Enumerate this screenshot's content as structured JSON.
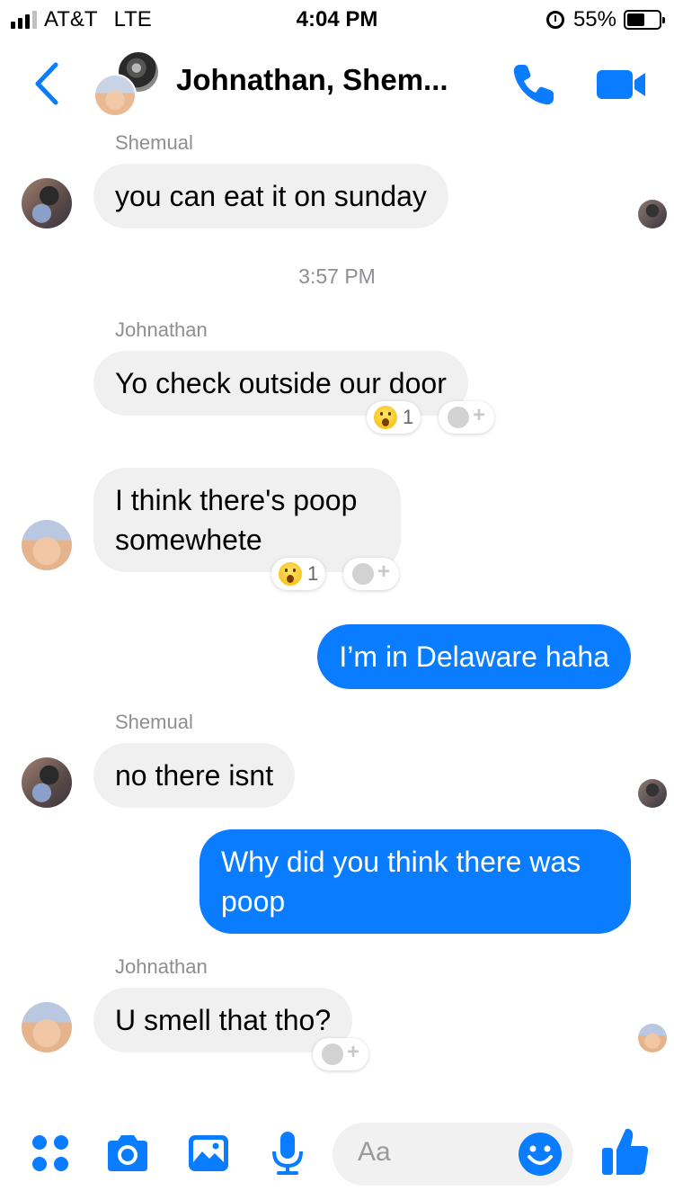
{
  "status_bar": {
    "carrier": "AT&T",
    "network": "LTE",
    "time": "4:04 PM",
    "battery": "55%",
    "battery_level": 0.55,
    "signal_bars": 3
  },
  "header": {
    "title": "Johnathan, Shem...",
    "back_icon": "chevron-left-icon",
    "call_icon": "phone-icon",
    "video_icon": "video-camera-icon"
  },
  "messages": [
    {
      "sender_label": "Shemual",
      "text": "you can eat it on sunday",
      "direction": "in"
    },
    {
      "timestamp": "3:57 PM"
    },
    {
      "sender_label": "Johnathan",
      "text": "Yo check outside our door",
      "direction": "in",
      "reaction": {
        "emoji": "wow",
        "count": "1"
      }
    },
    {
      "text_line1": "I think there's poop",
      "text_line2": "somewhete",
      "direction": "in",
      "reaction": {
        "emoji": "wow",
        "count": "1"
      }
    },
    {
      "text": "I’m in Delaware haha",
      "direction": "out"
    },
    {
      "sender_label": "Shemual",
      "text": "no there isnt",
      "direction": "in"
    },
    {
      "text_line1": "Why did you think there was",
      "text_line2": "poop",
      "direction": "out"
    },
    {
      "sender_label": "Johnathan",
      "text": "U smell that tho?",
      "direction": "in"
    }
  ],
  "composer": {
    "placeholder": "Aa"
  },
  "colors": {
    "accent": "#0a7cff",
    "incoming_bubble": "#f0f0f0",
    "meta_text": "#8e8e93"
  }
}
